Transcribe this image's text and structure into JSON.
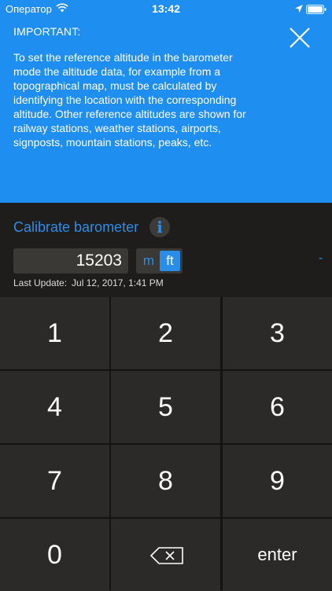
{
  "status_bar": {
    "carrier": "Оператор",
    "time": "13:42"
  },
  "info_panel": {
    "title": "IMPORTANT:",
    "text": "To set the reference altitude in the barometer mode the altitude data, for example from a topographical map, must be calculated by identifying the location with the corresponding altitude. Other reference altitudes are shown for railway stations, weather stations, airports, signposts, mountain stations, peaks, etc."
  },
  "calibration": {
    "title": "Calibrate barometer",
    "info_label": "i",
    "value": "15203",
    "units": [
      "m",
      "ft"
    ],
    "selected_unit": "ft",
    "dash": "-",
    "last_update_label": "Last Update:",
    "last_update_value": "Jul 12, 2017, 1:41 PM"
  },
  "keypad": {
    "keys": [
      "1",
      "2",
      "3",
      "4",
      "5",
      "6",
      "7",
      "8",
      "9",
      "0"
    ],
    "enter_label": "enter"
  },
  "colors": {
    "panel_blue": "#1f8ef1",
    "accent_blue": "#2a8de8",
    "background": "#1f1d1b",
    "key_bg": "#2b2a28"
  },
  "icons": [
    "wifi-icon",
    "location-arrow-icon",
    "battery-icon",
    "close-icon",
    "info-icon",
    "backspace-icon"
  ]
}
